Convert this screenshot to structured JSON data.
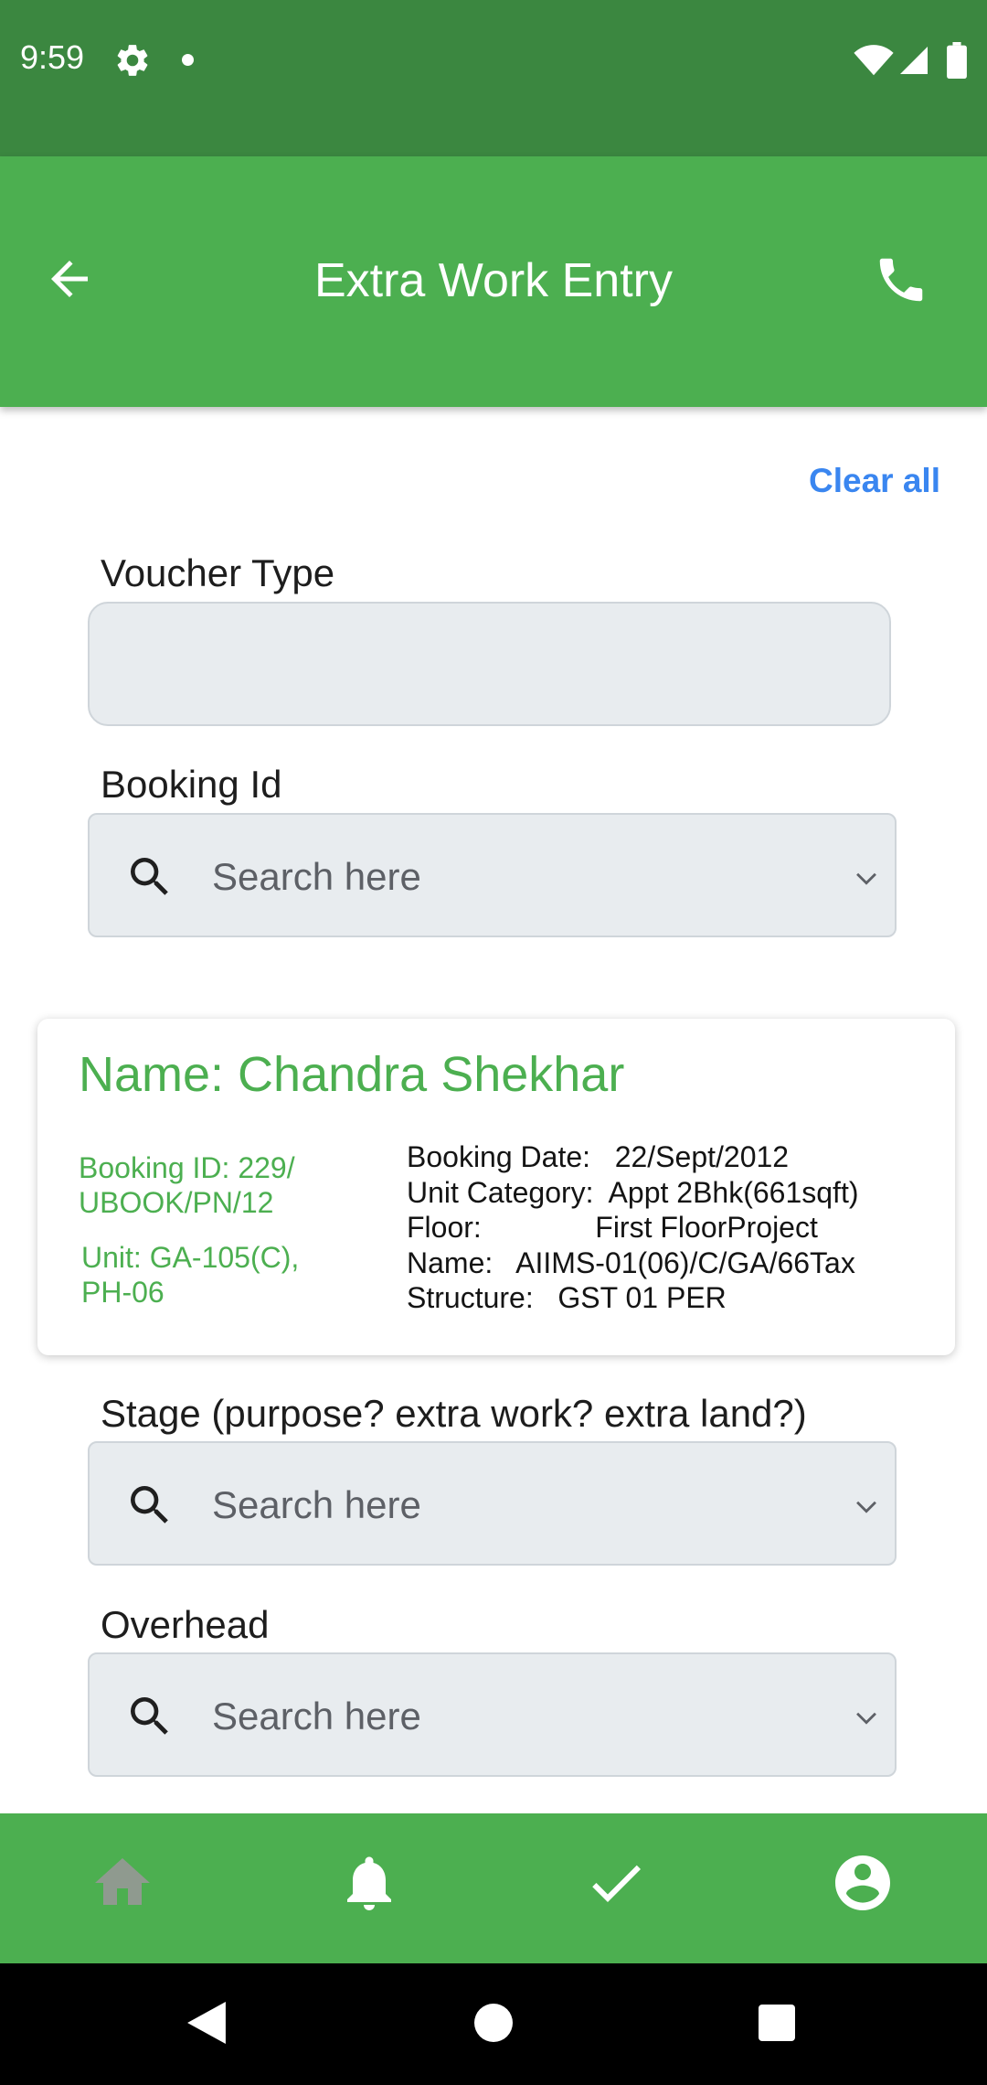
{
  "status_bar": {
    "time": "9:59"
  },
  "app_bar": {
    "title": "Extra Work Entry"
  },
  "actions": {
    "clear_all": "Clear all"
  },
  "form": {
    "voucher_type": {
      "label": "Voucher Type",
      "value": ""
    },
    "booking_id": {
      "label": "Booking Id",
      "placeholder": "Search here"
    },
    "stage": {
      "label": "Stage (purpose? extra work? extra land?)",
      "placeholder": "Search here"
    },
    "overhead": {
      "label": "Overhead",
      "placeholder": "Search here"
    }
  },
  "booking_card": {
    "name": "Name: Chandra Shekhar",
    "booking_id_line1": "Booking ID: 229/",
    "booking_id_line2": "UBOOK/PN/12",
    "unit_line1": "Unit: GA-105(C),",
    "unit_line2": "PH-06",
    "details": [
      "Booking Date:   22/Sept/2012",
      "Unit Category:  Appt 2Bhk(661sqft)",
      "Floor:              First FloorProject",
      "Name:   AIIMS-01(06)/C/GA/66Tax",
      "Structure:   GST 01 PER"
    ]
  },
  "bottom_nav": {
    "items": [
      "home-icon",
      "bell-icon",
      "check-icon",
      "account-icon"
    ],
    "colors": {
      "active": "#ffffff",
      "inactive": "#8f9a8f"
    }
  },
  "colors": {
    "status_bar": "#3b8740",
    "primary": "#4caf50",
    "link": "#3a86f0",
    "field_bg": "#e8ecef"
  }
}
